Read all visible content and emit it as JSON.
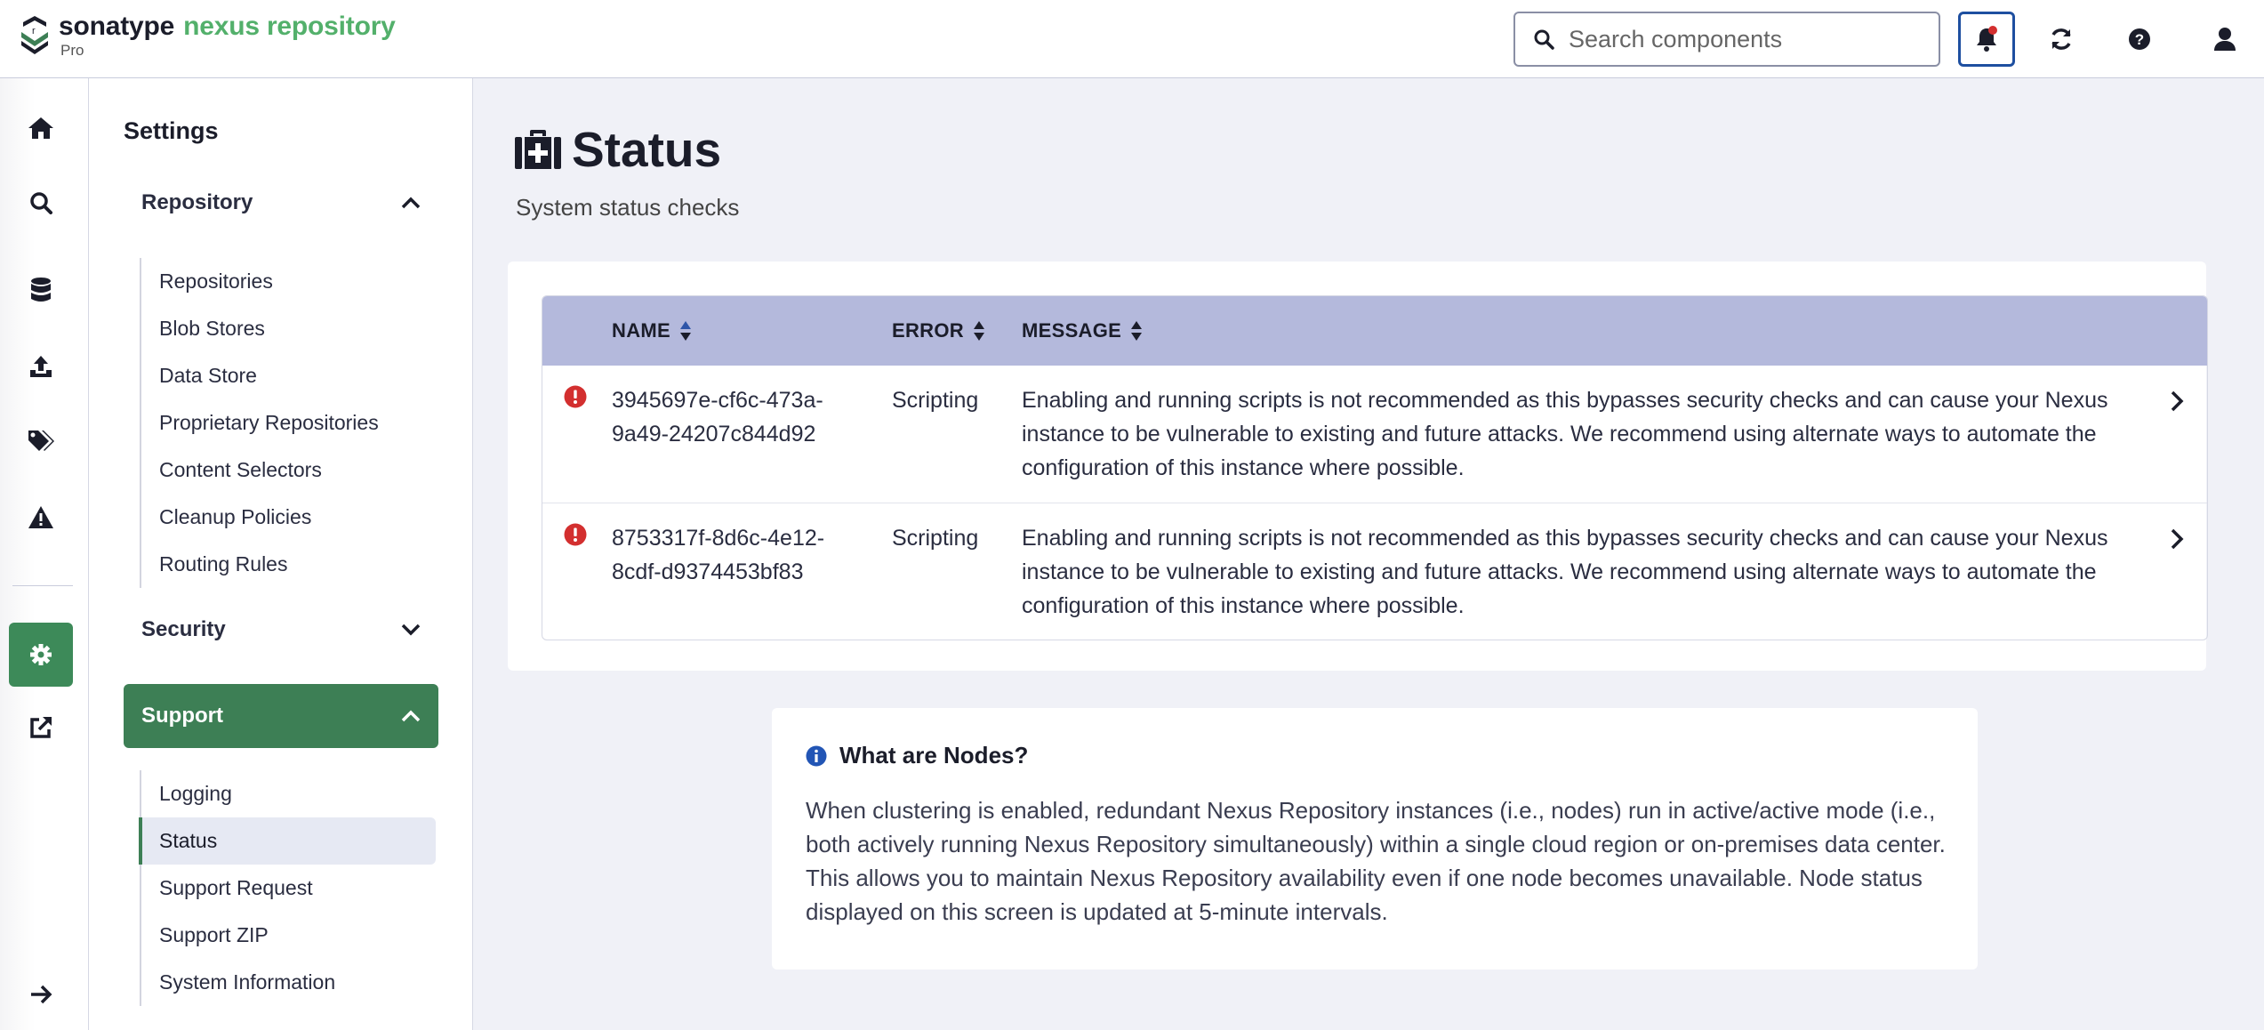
{
  "header": {
    "brand_sonatype": "sonatype",
    "brand_product": "nexus repository",
    "edition": "Pro",
    "search_placeholder": "Search components"
  },
  "colors": {
    "brand_green": "#53b06b",
    "active_green": "#3d7f55",
    "table_header": "#b4b9dc",
    "error_red": "#d32f2f",
    "info_blue": "#1e4fa0"
  },
  "rail": {
    "icons": [
      "home-icon",
      "search-icon",
      "database-icon",
      "upload-icon",
      "tags-icon",
      "warning-icon",
      "gear-icon",
      "external-link-icon",
      "expand-arrow-icon"
    ]
  },
  "settings": {
    "title": "Settings",
    "repository": {
      "label": "Repository",
      "items": [
        "Repositories",
        "Blob Stores",
        "Data Store",
        "Proprietary Repositories",
        "Content Selectors",
        "Cleanup Policies",
        "Routing Rules"
      ]
    },
    "security": {
      "label": "Security"
    },
    "support": {
      "label": "Support",
      "items": [
        "Logging",
        "Status",
        "Support Request",
        "Support ZIP",
        "System Information"
      ],
      "selected": "Status"
    }
  },
  "page": {
    "title": "Status",
    "subtitle": "System status checks"
  },
  "table": {
    "columns": [
      "NAME",
      "ERROR",
      "MESSAGE"
    ],
    "rows": [
      {
        "name": "3945697e-cf6c-473a-9a49-24207c844d92",
        "error": "Scripting",
        "message": "Enabling and running scripts is not recommended as this bypasses security checks and can cause your Nexus instance to be vulnerable to existing and future attacks. We recommend using alternate ways to automate the configuration of this instance where possible."
      },
      {
        "name": "8753317f-8d6c-4e12-8cdf-d9374453bf83",
        "error": "Scripting",
        "message": "Enabling and running scripts is not recommended as this bypasses security checks and can cause your Nexus instance to be vulnerable to existing and future attacks. We recommend using alternate ways to automate the configuration of this instance where possible."
      }
    ]
  },
  "nodes_info": {
    "title": "What are Nodes?",
    "text": "When clustering is enabled, redundant Nexus Repository instances (i.e., nodes) run in active/active mode (i.e., both actively running Nexus Repository simultaneously) within a single cloud region or on-premises data center. This allows you to maintain Nexus Repository availability even if one node becomes unavailable. Node status displayed on this screen is updated at 5-minute intervals."
  }
}
